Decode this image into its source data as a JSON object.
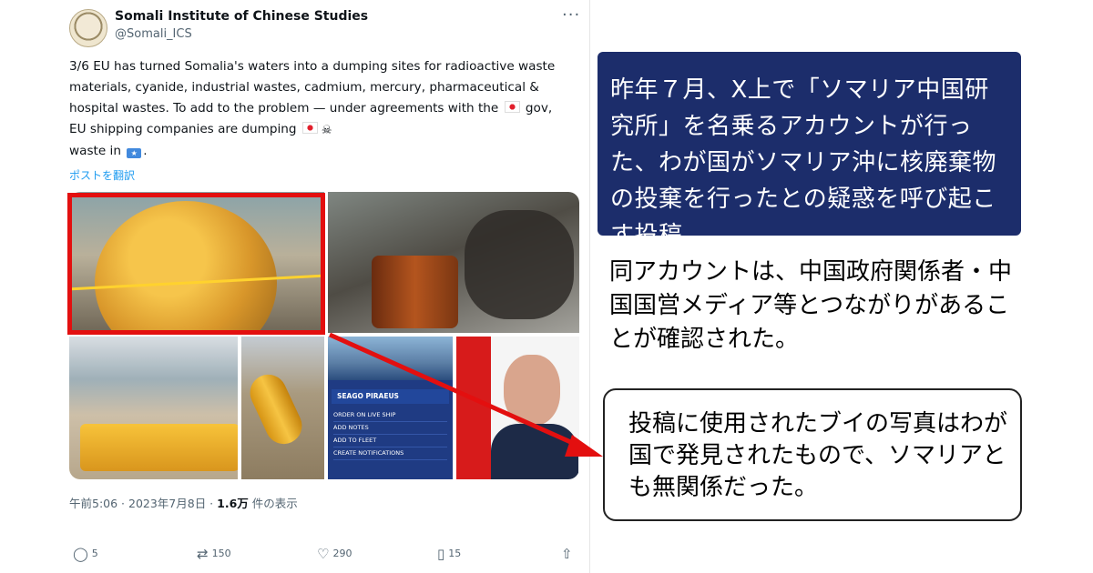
{
  "tweet": {
    "author_name": "Somali Institute of Chinese Studies",
    "author_handle": "@Somali_ICS",
    "more_label": "···",
    "text_part1": "3/6 EU has turned Somalia's waters into a dumping sites for radioactive waste materials, cyanide, industrial wastes, cadmium, mercury, pharmaceutical & hospital wastes. To add to the problem — under agreements with the ",
    "text_part2": " gov, EU shipping companies are dumping ",
    "text_part3": " waste in ",
    "text_part4": ".",
    "translate_link": "ポストを翻訳",
    "timestamp": "午前5:06 · 2023年7月8日 · ",
    "views_count": "1.6万",
    "views_label": " 件の表示",
    "replies": "5",
    "reposts": "150",
    "likes": "290",
    "bookmarks": "15"
  },
  "media": {
    "app_title": "SEAGO PIRAEUS",
    "app_menu": [
      "ORDER ON LIVE SHIP",
      "ADD NOTES",
      "ADD TO FLEET",
      "CREATE NOTIFICATIONS"
    ]
  },
  "annotations": {
    "headline": "昨年７月、X上で「ソマリア中国研究所」を名乗るアカウントが行った、わが国がソマリア沖に核廃棄物の投棄を行ったとの疑惑を呼び起こす投稿。",
    "affiliation": "同アカウントは、中国政府関係者・中国国営メディア等とつながりがあることが確認された。",
    "callout": "投稿に使用されたブイの写真はわが国で発見されたもので、ソマリアとも無関係だった。"
  },
  "colors": {
    "navy_box": "#1c2d6b",
    "highlight_red": "#e30f0f",
    "link_blue": "#1d9bf0"
  },
  "icons": {
    "reply": "reply-icon",
    "repost": "repost-icon",
    "like": "heart-icon",
    "bookmark": "bookmark-icon",
    "share": "share-icon"
  }
}
